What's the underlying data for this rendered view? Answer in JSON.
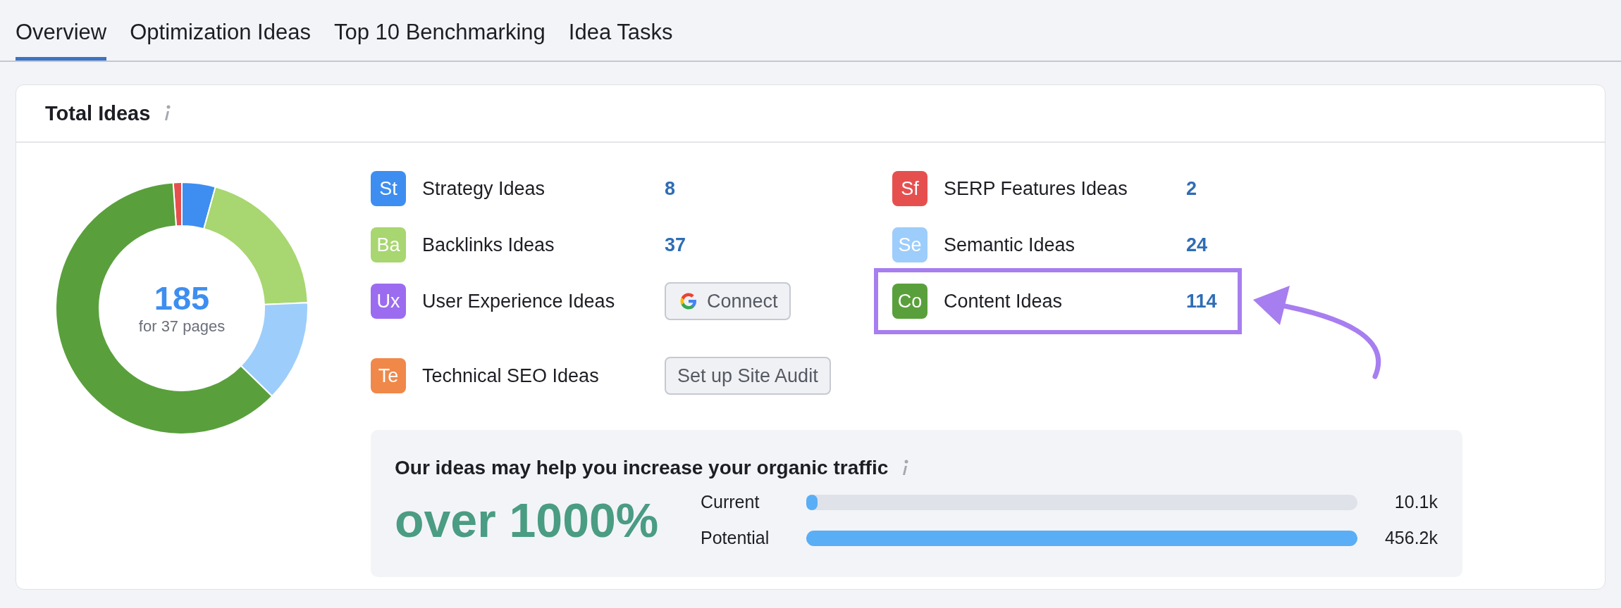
{
  "tabs": [
    {
      "label": "Overview",
      "selected": true
    },
    {
      "label": "Optimization Ideas",
      "selected": false
    },
    {
      "label": "Top 10 Benchmarking",
      "selected": false
    },
    {
      "label": "Idea Tasks",
      "selected": false
    }
  ],
  "card": {
    "title": "Total Ideas",
    "donut": {
      "total": "185",
      "caption": "for 37 pages",
      "chart_data": {
        "type": "donut",
        "values": [
          1.1,
          4.3,
          20.0,
          13.0,
          61.6
        ],
        "colors": [
          "#e5504f",
          "#3d8ef0",
          "#a8d670",
          "#9dcdfb",
          "#59a03c"
        ]
      }
    },
    "ideas": [
      {
        "badge": "St",
        "label": "Strategy Ideas",
        "color": "#3d8ef0",
        "kind": "count",
        "value": "8",
        "highlighted": false
      },
      {
        "badge": "Sf",
        "label": "SERP Features Ideas",
        "color": "#e5504f",
        "kind": "count",
        "value": "2",
        "highlighted": false
      },
      {
        "badge": "Ba",
        "label": "Backlinks Ideas",
        "color": "#a8d670",
        "kind": "count",
        "value": "37",
        "highlighted": false
      },
      {
        "badge": "Se",
        "label": "Semantic Ideas",
        "color": "#9dcdfb",
        "kind": "count",
        "value": "24",
        "highlighted": false
      },
      {
        "badge": "Ux",
        "label": "User Experience Ideas",
        "color": "#9b6cf0",
        "kind": "connect",
        "button": "Connect",
        "highlighted": false
      },
      {
        "badge": "Co",
        "label": "Content Ideas",
        "color": "#59a03c",
        "kind": "count",
        "value": "114",
        "highlighted": true
      },
      {
        "badge": "Te",
        "label": "Technical SEO Ideas",
        "color": "#f0884a",
        "kind": "setup",
        "button": "Set up Site Audit",
        "highlighted": false
      }
    ],
    "traffic": {
      "title": "Our ideas may help you increase your organic traffic",
      "headline": "over 1000%",
      "bars": [
        {
          "label": "Current",
          "level": 0.02,
          "reading": "10.1k"
        },
        {
          "label": "Potential",
          "level": 1,
          "reading": "456.2k"
        }
      ]
    }
  }
}
